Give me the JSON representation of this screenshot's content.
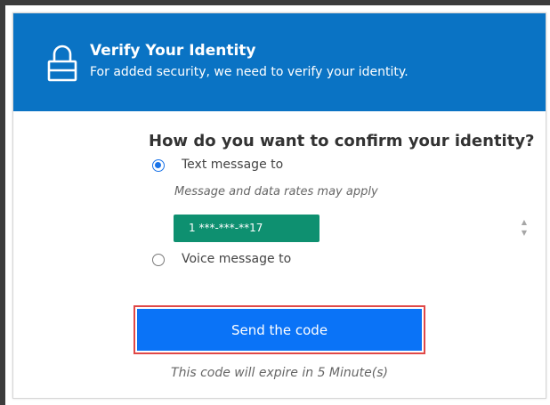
{
  "header": {
    "icon": "lock-icon",
    "title": "Verify Your Identity",
    "subtitle": "For added security, we need to verify your identity.",
    "background_color": "#0a73c4"
  },
  "main": {
    "question": "How do you want to confirm your identity?",
    "options": [
      {
        "label": "Text message to",
        "selected": true,
        "note": "Message and data rates may apply",
        "phone_number": "1 ***-***-**17"
      },
      {
        "label": "Voice message to",
        "selected": false
      }
    ],
    "phone_option_color": "#0e9070",
    "stepper": {
      "up_icon": "caret-up-icon",
      "down_icon": "caret-down-icon",
      "up_glyph": "▲",
      "down_glyph": "▼"
    },
    "send_button": {
      "label": "Send the code",
      "color": "#0a73f7",
      "highlight_color": "#e04848"
    },
    "expire_text": "This code will expire in 5 Minute(s)"
  }
}
